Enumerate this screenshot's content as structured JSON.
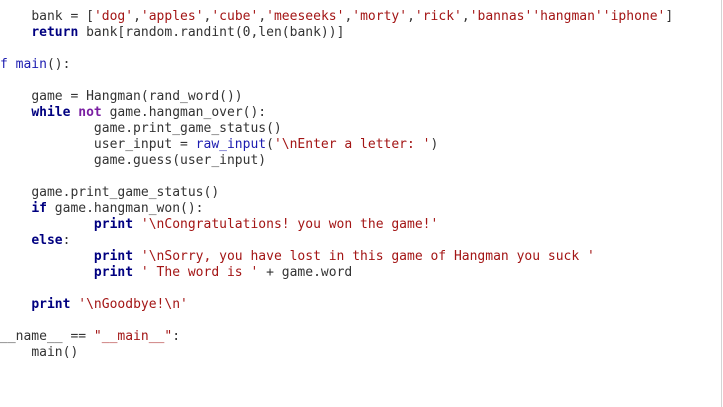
{
  "code": {
    "language": "python",
    "lines": [
      {
        "indent": "    ",
        "tokens": [
          {
            "t": "bank = [",
            "c": "op"
          },
          {
            "t": "'dog'",
            "c": "str"
          },
          {
            "t": ",",
            "c": "op"
          },
          {
            "t": "'apples'",
            "c": "str"
          },
          {
            "t": ",",
            "c": "op"
          },
          {
            "t": "'cube'",
            "c": "str"
          },
          {
            "t": ",",
            "c": "op"
          },
          {
            "t": "'meeseeks'",
            "c": "str"
          },
          {
            "t": ",",
            "c": "op"
          },
          {
            "t": "'morty'",
            "c": "str"
          },
          {
            "t": ",",
            "c": "op"
          },
          {
            "t": "'rick'",
            "c": "str"
          },
          {
            "t": ",",
            "c": "op"
          },
          {
            "t": "'bannas'",
            "c": "str"
          },
          {
            "t": "'hangman'",
            "c": "str"
          },
          {
            "t": "'iphone'",
            "c": "str"
          },
          {
            "t": "]",
            "c": "op"
          }
        ]
      },
      {
        "indent": "    ",
        "tokens": [
          {
            "t": "return",
            "c": "kw"
          },
          {
            "t": " bank[random.randint(",
            "c": "op"
          },
          {
            "t": "0",
            "c": "num"
          },
          {
            "t": ",len(bank))]",
            "c": "op"
          }
        ]
      },
      {
        "indent": "",
        "tokens": []
      },
      {
        "indent": "",
        "tokens": [
          {
            "t": "f main",
            "c": "fn"
          },
          {
            "t": "():",
            "c": "op"
          }
        ]
      },
      {
        "indent": "",
        "tokens": []
      },
      {
        "indent": "    ",
        "tokens": [
          {
            "t": "game = Hangman(rand_word())",
            "c": "op"
          }
        ]
      },
      {
        "indent": "    ",
        "tokens": [
          {
            "t": "while",
            "c": "kw"
          },
          {
            "t": " ",
            "c": "op"
          },
          {
            "t": "not",
            "c": "kw2"
          },
          {
            "t": " game.hangman_over():",
            "c": "op"
          }
        ]
      },
      {
        "indent": "            ",
        "tokens": [
          {
            "t": "game.print_game_status()",
            "c": "op"
          }
        ]
      },
      {
        "indent": "            ",
        "tokens": [
          {
            "t": "user_input = ",
            "c": "op"
          },
          {
            "t": "raw_input",
            "c": "fn"
          },
          {
            "t": "(",
            "c": "op"
          },
          {
            "t": "'\\nEnter a letter: '",
            "c": "str"
          },
          {
            "t": ")",
            "c": "op"
          }
        ]
      },
      {
        "indent": "            ",
        "tokens": [
          {
            "t": "game.guess(user_input)",
            "c": "op"
          }
        ]
      },
      {
        "indent": "",
        "tokens": []
      },
      {
        "indent": "    ",
        "tokens": [
          {
            "t": "game.print_game_status()",
            "c": "op"
          }
        ]
      },
      {
        "indent": "    ",
        "tokens": [
          {
            "t": "if",
            "c": "kw"
          },
          {
            "t": " game.hangman_won():",
            "c": "op"
          }
        ]
      },
      {
        "indent": "            ",
        "tokens": [
          {
            "t": "print",
            "c": "kw"
          },
          {
            "t": " ",
            "c": "op"
          },
          {
            "t": "'\\nCongratulations! you won the game!'",
            "c": "str"
          }
        ]
      },
      {
        "indent": "    ",
        "tokens": [
          {
            "t": "else",
            "c": "kw"
          },
          {
            "t": ":",
            "c": "op"
          }
        ]
      },
      {
        "indent": "            ",
        "tokens": [
          {
            "t": "print",
            "c": "kw"
          },
          {
            "t": " ",
            "c": "op"
          },
          {
            "t": "'\\nSorry, you have lost in this game of Hangman you suck '",
            "c": "str"
          }
        ]
      },
      {
        "indent": "            ",
        "tokens": [
          {
            "t": "print",
            "c": "kw"
          },
          {
            "t": " ",
            "c": "op"
          },
          {
            "t": "' The word is '",
            "c": "str"
          },
          {
            "t": " + game.word",
            "c": "op"
          }
        ]
      },
      {
        "indent": "",
        "tokens": []
      },
      {
        "indent": "    ",
        "tokens": [
          {
            "t": "print",
            "c": "kw"
          },
          {
            "t": " ",
            "c": "op"
          },
          {
            "t": "'\\nGoodbye!\\n'",
            "c": "str"
          }
        ]
      },
      {
        "indent": "",
        "tokens": []
      },
      {
        "indent": "",
        "tokens": [
          {
            "t": "__name__ == ",
            "c": "op"
          },
          {
            "t": "\"__main__\"",
            "c": "str"
          },
          {
            "t": ":",
            "c": "op"
          }
        ]
      },
      {
        "indent": "    ",
        "tokens": [
          {
            "t": "main()",
            "c": "op"
          }
        ]
      }
    ]
  }
}
